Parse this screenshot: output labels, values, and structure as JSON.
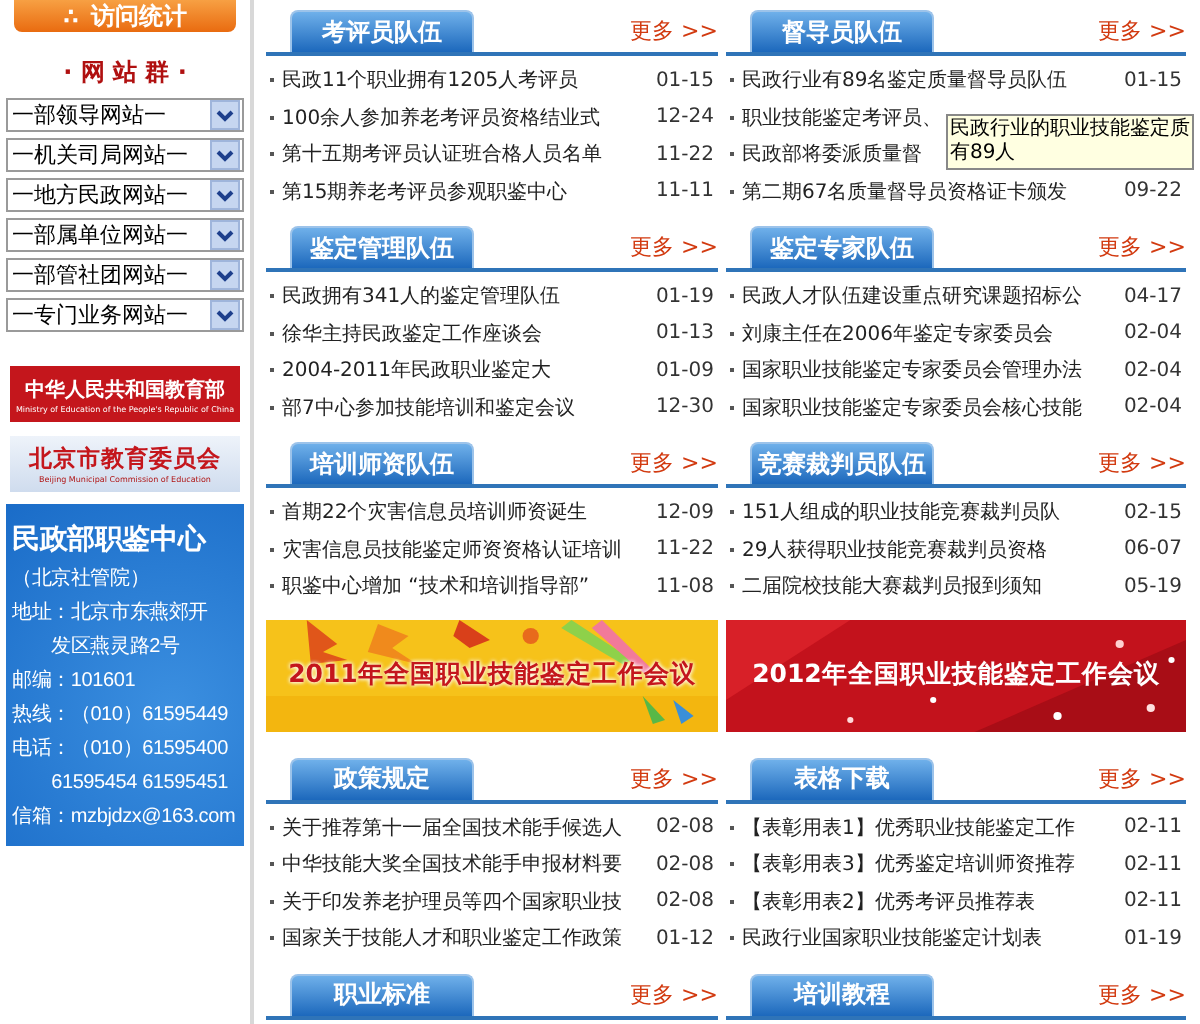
{
  "sidebar": {
    "stats_icon": "∴",
    "stats_title": "访问统计",
    "sites_heading": "· 网 站 群 ·",
    "site_dropdowns": [
      "一部领导网站一",
      "一机关司局网站一",
      "一地方民政网站一",
      "一部属单位网站一",
      "一部管社团网站一",
      "一专门业务网站一"
    ],
    "logos": [
      {
        "kind": "red",
        "title": "中华人民共和国教育部",
        "subtitle": "Ministry of Education of the People's Republic of China"
      },
      {
        "kind": "light",
        "title": "北京市教育委员会",
        "subtitle": "Beijing Municipal Commission of Education"
      }
    ],
    "contact": {
      "title": "民政部职鉴中心",
      "subtitle": "（北京社管院）",
      "lines": [
        "地址：北京市东燕郊开",
        "　　发区燕灵路2号",
        "邮编：101601",
        "热线：（010）61595449",
        "电话：（010）61595400",
        "　　61595454 61595451",
        "信箱：mzbjdzx@163.com"
      ]
    }
  },
  "blocks": [
    {
      "kind": "section",
      "title": "考评员队伍",
      "more": "更多 >>",
      "items": [
        {
          "text": "民政11个职业拥有1205人考评员",
          "date": "01-15"
        },
        {
          "text": "100余人参加养老考评员资格结业式",
          "date": "12-24"
        },
        {
          "text": "第十五期考评员认证班合格人员名单",
          "date": "11-22"
        },
        {
          "text": "第15期养老考评员参观职鉴中心",
          "date": "11-11"
        }
      ]
    },
    {
      "kind": "section",
      "title": "督导员队伍",
      "more": "更多 >>",
      "items": [
        {
          "text": "民政行业有89名鉴定质量督导员队伍",
          "date": "01-15"
        },
        {
          "text": "职业技能鉴定考评员、"
        },
        {
          "text": "民政部将委派质量督"
        },
        {
          "text": "第二期67名质量督导员资格证卡颁发",
          "date": "09-22"
        }
      ],
      "tooltip": [
        "民政行业的职业技能鉴定质",
        "有89人"
      ]
    },
    {
      "kind": "section",
      "title": "鉴定管理队伍",
      "more": "更多 >>",
      "items": [
        {
          "text": "民政拥有341人的鉴定管理队伍",
          "date": "01-19"
        },
        {
          "text": "徐华主持民政鉴定工作座谈会",
          "date": "01-13"
        },
        {
          "text": "2004-2011年民政职业鉴定大",
          "date": "01-09"
        },
        {
          "text": "部7中心参加技能培训和鉴定会议",
          "date": "12-30"
        }
      ]
    },
    {
      "kind": "section",
      "title": "鉴定专家队伍",
      "more": "更多 >>",
      "items": [
        {
          "text": "民政人才队伍建设重点研究课题招标公",
          "date": "04-17"
        },
        {
          "text": "刘康主任在2006年鉴定专家委员会",
          "date": "02-04"
        },
        {
          "text": "国家职业技能鉴定专家委员会管理办法",
          "date": "02-04"
        },
        {
          "text": "国家职业技能鉴定专家委员会核心技能",
          "date": "02-04"
        }
      ]
    },
    {
      "kind": "section",
      "title": "培训师资队伍",
      "more": "更多 >>",
      "items": [
        {
          "text": "首期22个灾害信息员培训师资诞生",
          "date": "12-09"
        },
        {
          "text": "灾害信息员技能鉴定师资资格认证培训",
          "date": "11-22"
        },
        {
          "text": "职鉴中心增加 “技术和培训指导部”",
          "date": "11-08"
        }
      ]
    },
    {
      "kind": "section",
      "title": "竞赛裁判员队伍",
      "more": "更多 >>",
      "items": [
        {
          "text": "151人组成的职业技能竞赛裁判员队",
          "date": "02-15"
        },
        {
          "text": "29人获得职业技能竞赛裁判员资格",
          "date": "06-07"
        },
        {
          "text": "二届院校技能大赛裁判员报到须知",
          "date": "05-19"
        }
      ]
    },
    {
      "kind": "banner",
      "title": "2011年全国职业技能鉴定工作会议"
    },
    {
      "kind": "banner",
      "title": "2012年全国职业技能鉴定工作会议"
    },
    {
      "kind": "section",
      "title": "政策规定",
      "more": "更多 >>",
      "items": [
        {
          "text": "关于推荐第十一届全国技术能手候选人",
          "date": "02-08"
        },
        {
          "text": "中华技能大奖全国技术能手申报材料要",
          "date": "02-08"
        },
        {
          "text": "关于印发养老护理员等四个国家职业技",
          "date": "02-08"
        },
        {
          "text": "国家关于技能人才和职业鉴定工作政策",
          "date": "01-12"
        }
      ]
    },
    {
      "kind": "section",
      "title": "表格下载",
      "more": "更多 >>",
      "items": [
        {
          "text": "【表彰用表1】优秀职业技能鉴定工作",
          "date": "02-11"
        },
        {
          "text": "【表彰用表3】优秀鉴定培训师资推荐",
          "date": "02-11"
        },
        {
          "text": "【表彰用表2】优秀考评员推荐表",
          "date": "02-11"
        },
        {
          "text": "民政行业国家职业技能鉴定计划表",
          "date": "01-19"
        }
      ]
    },
    {
      "kind": "section",
      "title": "职业标准",
      "more": "更多 >>"
    },
    {
      "kind": "section",
      "title": "培训教程",
      "more": "更多 >>"
    }
  ]
}
